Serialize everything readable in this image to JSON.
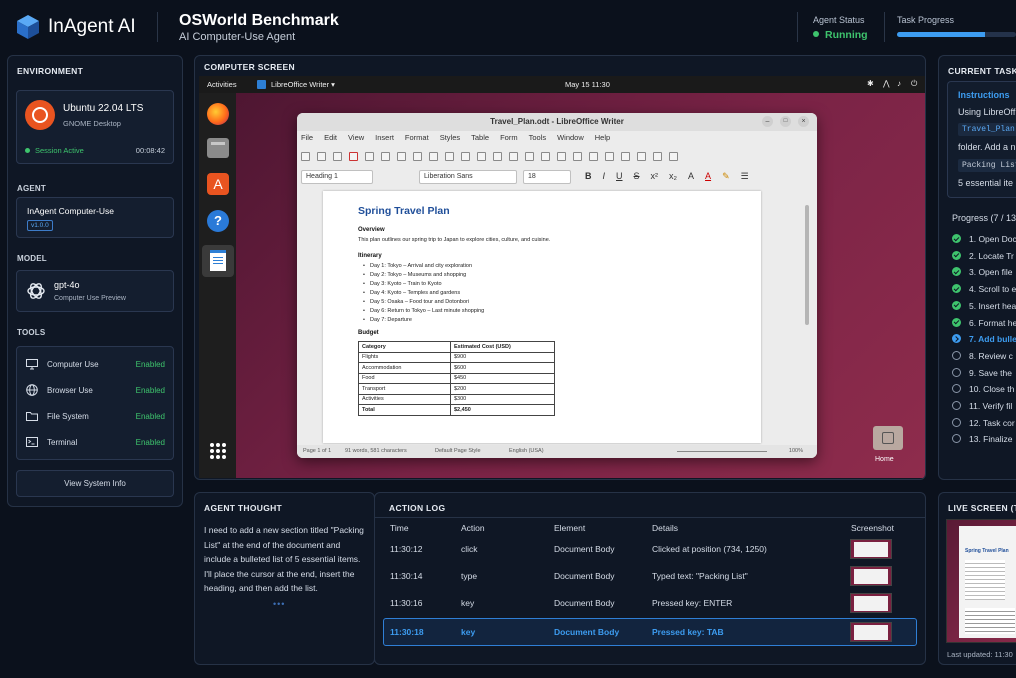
{
  "header": {
    "brand": "InAgent AI",
    "title": "OSWorld Benchmark",
    "subtitle": "AI Computer-Use Agent",
    "agent_status_label": "Agent Status",
    "agent_status_value": "Running",
    "task_progress_label": "Task Progress",
    "task_progress_fraction": 0.74
  },
  "environment": {
    "title": "ENVIRONMENT",
    "os_name": "Ubuntu 22.04 LTS",
    "desktop": "GNOME Desktop",
    "session": "Session Active",
    "timer": "00:08:42"
  },
  "agent": {
    "title": "AGENT",
    "name": "InAgent Computer-Use",
    "version": "v1.0.0"
  },
  "model": {
    "title": "MODEL",
    "name": "gpt-4o",
    "desc": "Computer Use Preview"
  },
  "tools": {
    "title": "TOOLS",
    "items": [
      {
        "label": "Computer Use",
        "status": "Enabled",
        "icon": "monitor-icon"
      },
      {
        "label": "Browser Use",
        "status": "Enabled",
        "icon": "globe-icon"
      },
      {
        "label": "File System",
        "status": "Enabled",
        "icon": "folder-icon"
      },
      {
        "label": "Terminal",
        "status": "Enabled",
        "icon": "terminal-icon"
      }
    ],
    "view_button": "View System Info"
  },
  "screen": {
    "title": "COMPUTER SCREEN",
    "activities": "Activities",
    "app_menu": "LibreOffice Writer ▾",
    "clock": "May 15  11:30",
    "home_label": "Home",
    "writer": {
      "window_title": "Travel_Plan.odt - LibreOffice Writer",
      "menu": [
        "File",
        "Edit",
        "View",
        "Insert",
        "Format",
        "Styles",
        "Table",
        "Form",
        "Tools",
        "Window",
        "Help"
      ],
      "style": "Heading 1",
      "font": "Liberation Sans",
      "size": "18",
      "doc_title": "Spring Travel Plan",
      "overview_h": "Overview",
      "overview_text": "This plan outlines our spring trip to Japan to explore cities, culture, and cuisine.",
      "itinerary_h": "Itinerary",
      "itinerary": [
        "Day 1: Tokyo – Arrival and city exploration",
        "Day 2: Tokyo – Museums and shopping",
        "Day 3: Kyoto – Train to Kyoto",
        "Day 4: Kyoto – Temples and gardens",
        "Day 5: Osaka – Food tour and Dotonbori",
        "Day 6: Return to Tokyo – Last minute shopping",
        "Day 7: Departure"
      ],
      "budget_h": "Budget",
      "budget_headers": [
        "Category",
        "Estimated Cost (USD)"
      ],
      "budget_rows": [
        [
          "Flights",
          "$900"
        ],
        [
          "Accommodation",
          "$600"
        ],
        [
          "Food",
          "$450"
        ],
        [
          "Transport",
          "$200"
        ],
        [
          "Activities",
          "$300"
        ],
        [
          "Total",
          "$2,450"
        ]
      ],
      "status_page": "Page 1 of 1",
      "status_words": "91 words, 581 characters",
      "status_style": "Default Page Style",
      "status_lang": "English (USA)",
      "status_zoom": "100%"
    }
  },
  "thought": {
    "title": "AGENT THOUGHT",
    "text": "I need to add a new section titled \"Packing List\" at the end of the document and include a bulleted list of 5 essential items. I'll place the cursor at the end, insert the heading, and then add the list.",
    "dots": "•••"
  },
  "log": {
    "title": "ACTION LOG",
    "headers": [
      "Time",
      "Action",
      "Element",
      "Details",
      "Screenshot"
    ],
    "rows": [
      {
        "time": "11:30:12",
        "action": "click",
        "element": "Document Body",
        "details": "Clicked at position (734, 1250)"
      },
      {
        "time": "11:30:14",
        "action": "type",
        "element": "Document Body",
        "details": "Typed text: \"Packing List\""
      },
      {
        "time": "11:30:16",
        "action": "key",
        "element": "Document Body",
        "details": "Pressed key: ENTER"
      },
      {
        "time": "11:30:18",
        "action": "key",
        "element": "Document Body",
        "details": "Pressed key: TAB"
      }
    ]
  },
  "task": {
    "title": "CURRENT TASK",
    "instructions_h": "Instructions",
    "instr_line1": "Using LibreOff",
    "instr_code1": "Travel_Plan",
    "instr_line2": "folder. Add a n",
    "instr_code2": "Packing List",
    "instr_line3": "5 essential ite",
    "progress_label": "Progress (7 / 13",
    "steps": [
      {
        "label": "1.  Open Doc",
        "state": "done"
      },
      {
        "label": "2.  Locate Tr",
        "state": "done"
      },
      {
        "label": "3.  Open file",
        "state": "done"
      },
      {
        "label": "4.  Scroll to e",
        "state": "done"
      },
      {
        "label": "5.  Insert hea",
        "state": "done"
      },
      {
        "label": "6.  Format he",
        "state": "done"
      },
      {
        "label": "7.  Add bulle",
        "state": "current"
      },
      {
        "label": "8.  Review c",
        "state": "todo"
      },
      {
        "label": "9.  Save the",
        "state": "todo"
      },
      {
        "label": "10.  Close th",
        "state": "todo"
      },
      {
        "label": "11.  Verify fil",
        "state": "todo"
      },
      {
        "label": "12.  Task cor",
        "state": "todo"
      },
      {
        "label": "13.  Finalize",
        "state": "todo"
      }
    ]
  },
  "live": {
    "title": "LIVE SCREEN (TH",
    "updated": "Last updated: 11:30"
  },
  "colors": {
    "accent": "#3d9cf0",
    "success": "#3ec46d",
    "background": "#0b111c",
    "desktop": "#7a2346"
  }
}
